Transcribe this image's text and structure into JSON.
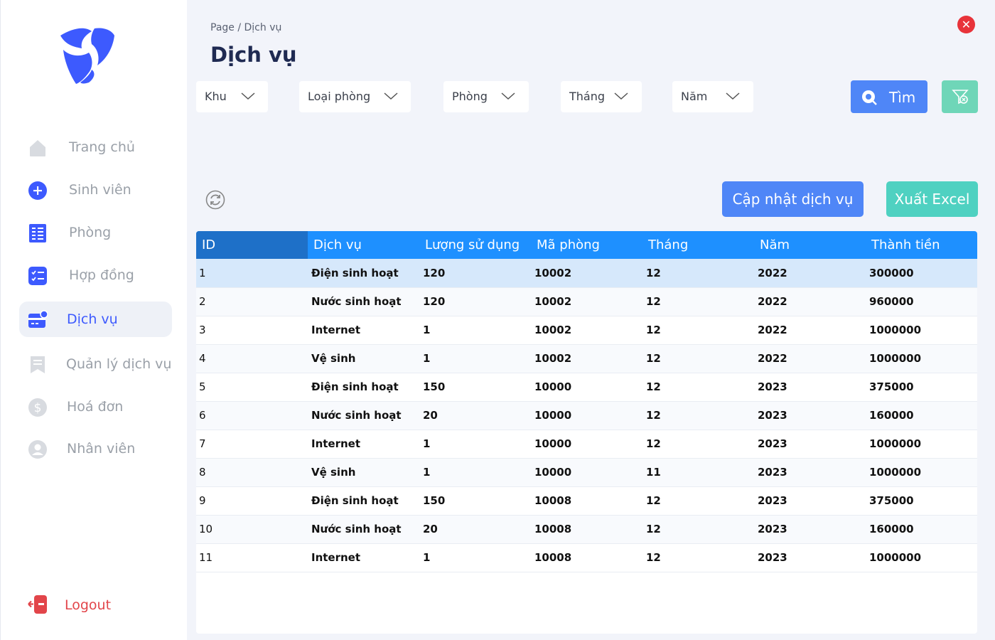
{
  "sidebar": {
    "items": [
      {
        "label": "Trang chủ",
        "icon": "home-icon"
      },
      {
        "label": "Sinh viên",
        "icon": "plus-circle-icon"
      },
      {
        "label": "Phòng",
        "icon": "room-list-icon"
      },
      {
        "label": "Hợp đồng",
        "icon": "checklist-icon"
      },
      {
        "label": "Dịch vụ",
        "icon": "service-card-icon"
      },
      {
        "label": "Quản lý dịch vụ",
        "icon": "bookmark-icon"
      },
      {
        "label": "Hoá đơn",
        "icon": "dollar-icon"
      },
      {
        "label": "Nhân viên",
        "icon": "user-icon"
      }
    ],
    "active_index": 4,
    "logout_label": "Logout"
  },
  "header": {
    "breadcrumb": "Page / Dịch vụ",
    "title": "Dịch vụ"
  },
  "filters": {
    "khu": "Khu",
    "loai_phong": "Loại phòng",
    "phong": "Phòng",
    "thang": "Tháng",
    "nam": "Năm",
    "search_label": "Tìm"
  },
  "actions": {
    "update_label": "Cập nhật dịch vụ",
    "excel_label": "Xuất Excel"
  },
  "table": {
    "columns": [
      "ID",
      "Dịch vụ",
      "Lượng sử dụng",
      "Mã phòng",
      "Tháng",
      "Năm",
      "Thành tiền"
    ],
    "rows": [
      [
        "1",
        "Điện sinh hoạt",
        "120",
        "10002",
        "12",
        "2022",
        "300000"
      ],
      [
        "2",
        "Nước sinh hoạt",
        "120",
        "10002",
        "12",
        "2022",
        "960000"
      ],
      [
        "3",
        "Internet",
        "1",
        "10002",
        "12",
        "2022",
        "1000000"
      ],
      [
        "4",
        "Vệ sinh",
        "1",
        "10002",
        "12",
        "2022",
        "1000000"
      ],
      [
        "5",
        "Điện sinh hoạt",
        "150",
        "10000",
        "12",
        "2023",
        "375000"
      ],
      [
        "6",
        "Nước sinh hoạt",
        "20",
        "10000",
        "12",
        "2023",
        "160000"
      ],
      [
        "7",
        "Internet",
        "1",
        "10000",
        "12",
        "2023",
        "1000000"
      ],
      [
        "8",
        "Vệ sinh",
        "1",
        "10000",
        "11",
        "2023",
        "1000000"
      ],
      [
        "9",
        "Điện sinh hoạt",
        "150",
        "10008",
        "12",
        "2023",
        "375000"
      ],
      [
        "10",
        "Nước sinh hoạt",
        "20",
        "10008",
        "12",
        "2023",
        "160000"
      ],
      [
        "11",
        "Internet",
        "1",
        "10008",
        "12",
        "2023",
        "1000000"
      ]
    ],
    "selected_row": 0
  },
  "colors": {
    "accent": "#3d5afe",
    "primary_button": "#4f86f7",
    "excel_button": "#4fd1c1",
    "header_row": "#1e90ff",
    "close": "#e8333a",
    "logout": "#e2454a"
  }
}
